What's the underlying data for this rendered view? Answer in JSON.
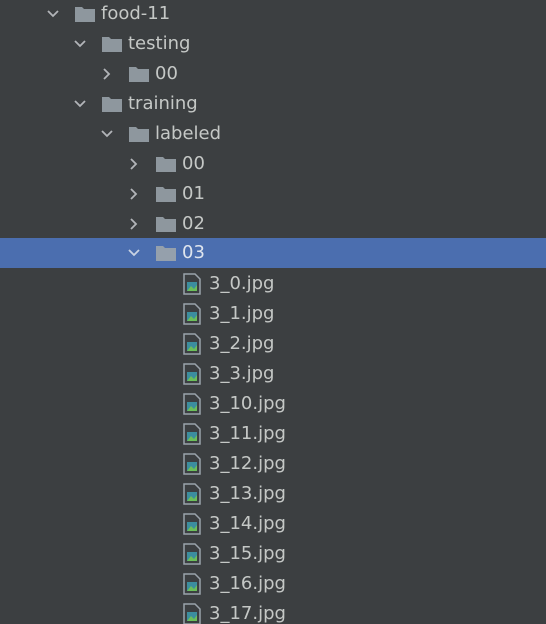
{
  "tree": {
    "nodes": [
      {
        "label": "food-11",
        "type": "folder",
        "expanded": true
      },
      {
        "label": "testing",
        "type": "folder",
        "expanded": true
      },
      {
        "label": "00",
        "type": "folder",
        "expanded": false
      },
      {
        "label": "training",
        "type": "folder",
        "expanded": true
      },
      {
        "label": "labeled",
        "type": "folder",
        "expanded": true
      },
      {
        "label": "00",
        "type": "folder",
        "expanded": false
      },
      {
        "label": "01",
        "type": "folder",
        "expanded": false
      },
      {
        "label": "02",
        "type": "folder",
        "expanded": false
      },
      {
        "label": "03",
        "type": "folder",
        "expanded": true,
        "selected": true
      },
      {
        "label": "3_0.jpg",
        "type": "image-file"
      },
      {
        "label": "3_1.jpg",
        "type": "image-file"
      },
      {
        "label": "3_2.jpg",
        "type": "image-file"
      },
      {
        "label": "3_3.jpg",
        "type": "image-file"
      },
      {
        "label": "3_10.jpg",
        "type": "image-file"
      },
      {
        "label": "3_11.jpg",
        "type": "image-file"
      },
      {
        "label": "3_12.jpg",
        "type": "image-file"
      },
      {
        "label": "3_13.jpg",
        "type": "image-file"
      },
      {
        "label": "3_14.jpg",
        "type": "image-file"
      },
      {
        "label": "3_15.jpg",
        "type": "image-file"
      },
      {
        "label": "3_16.jpg",
        "type": "image-file"
      },
      {
        "label": "3_17.jpg",
        "type": "image-file"
      }
    ]
  },
  "colors": {
    "background": "#3c3f41",
    "selection": "#4b6eaf",
    "folder_icon": "#8e979e",
    "text": "#c5c8c6",
    "chevron": "#b2b5b8"
  }
}
